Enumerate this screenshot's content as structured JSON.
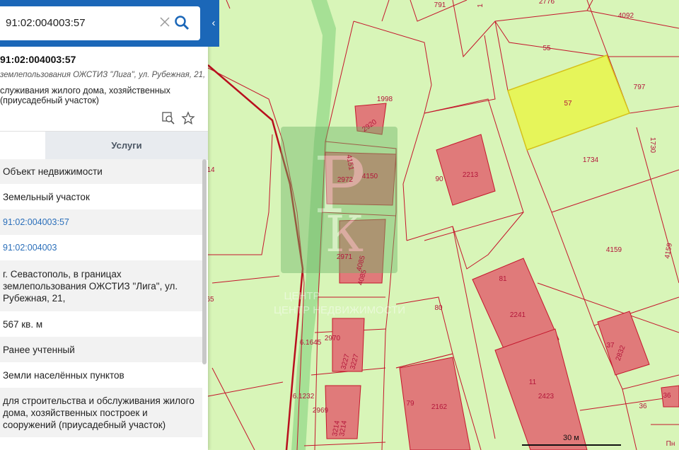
{
  "search": {
    "value": "91:02:004003:57"
  },
  "panel": {
    "title": "91:02:004003:57",
    "address_line": "землепользования ОЖСТИЗ \"Лига\", ул. Рубежная, 21,",
    "use_line": "служивания жилого дома, хозяйственных (приусадебный участок)",
    "tabs": {
      "services": "Услуги"
    },
    "rows": [
      "Объект недвижимости",
      "Земельный участок",
      "91:02:004003:57",
      "91:02:004003",
      "г. Севастополь, в границах землепользования ОЖСТИЗ \"Лига\", ул. Рубежная, 21,",
      "567 кв. м",
      "Ранее учтенный",
      "Земли населённых пунктов",
      "для строительства и обслуживания жилого дома, хозяйственных построек и сооружений (приусадебный участок)"
    ]
  },
  "map": {
    "watermark": "ЦЕНТР НЕДВИЖИМОСТИ",
    "scale_label": "30 м",
    "parcel_labels": [
      "791",
      "1",
      "2776",
      "4092",
      "55",
      "797",
      "57",
      "1998",
      "2920",
      "1730",
      "1734",
      "4151",
      "2972",
      "4150",
      "90",
      "2213",
      "4159",
      "4159",
      "14",
      "2971",
      "4085",
      "4085",
      "81",
      "80",
      "2241",
      "65",
      "2970",
      "6.1645",
      "3227",
      "3227",
      "37",
      "2832",
      "11",
      "2423",
      "6.1232",
      "79",
      "2162",
      "2969",
      "3214",
      "3214",
      "36",
      "36",
      "Пн"
    ],
    "colors": {
      "parcel_fill": "#d8f5b8",
      "parcel_border": "#c4162c",
      "building": "#e07a7a",
      "selected": "#e6f55a",
      "panel_accent": "#1b67b8"
    }
  }
}
